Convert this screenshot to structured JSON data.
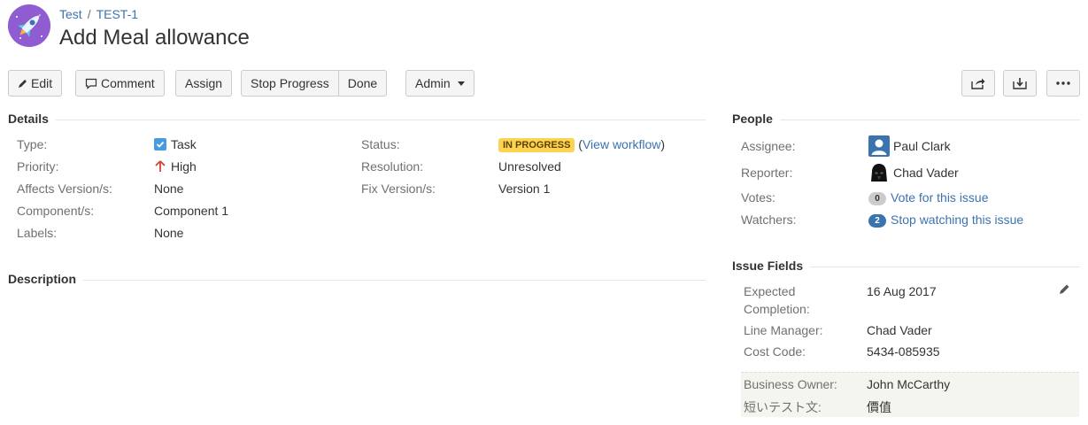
{
  "breadcrumb": {
    "project": "Test",
    "issue_key": "TEST-1"
  },
  "issue": {
    "title": "Add Meal allowance"
  },
  "toolbar": {
    "edit_label": "Edit",
    "comment_label": "Comment",
    "assign_label": "Assign",
    "stop_progress_label": "Stop Progress",
    "done_label": "Done",
    "admin_label": "Admin"
  },
  "details": {
    "heading": "Details",
    "type_label": "Type:",
    "type_value": "Task",
    "priority_label": "Priority:",
    "priority_value": "High",
    "affects_label": "Affects Version/s:",
    "affects_value": "None",
    "component_label": "Component/s:",
    "component_value": "Component 1",
    "labels_label": "Labels:",
    "labels_value": "None",
    "status_label": "Status:",
    "status_value": "IN PROGRESS",
    "view_workflow": "View workflow",
    "resolution_label": "Resolution:",
    "resolution_value": "Unresolved",
    "fix_label": "Fix Version/s:",
    "fix_value": "Version 1"
  },
  "description": {
    "heading": "Description"
  },
  "people": {
    "heading": "People",
    "assignee_label": "Assignee:",
    "assignee_value": "Paul Clark",
    "reporter_label": "Reporter:",
    "reporter_value": "Chad Vader",
    "votes_label": "Votes:",
    "votes_count": "0",
    "votes_link": "Vote for this issue",
    "watchers_label": "Watchers:",
    "watchers_count": "2",
    "watchers_link": "Stop watching this issue"
  },
  "issue_fields": {
    "heading": "Issue Fields",
    "expected_label_1": "Expected",
    "expected_label_2": "Completion:",
    "expected_value": "16 Aug 2017",
    "line_manager_label": "Line Manager:",
    "line_manager_value": "Chad Vader",
    "cost_code_label": "Cost Code:",
    "cost_code_value": "5434-085935",
    "business_owner_label": "Business Owner:",
    "business_owner_value": "John McCarthy",
    "short_text_label": "短いテスト文:",
    "short_text_value": "價值"
  },
  "colors": {
    "link": "#3b73af",
    "status_bg": "#ffd351",
    "priority_high": "#d04437",
    "task_blue": "#4a9ae1"
  }
}
